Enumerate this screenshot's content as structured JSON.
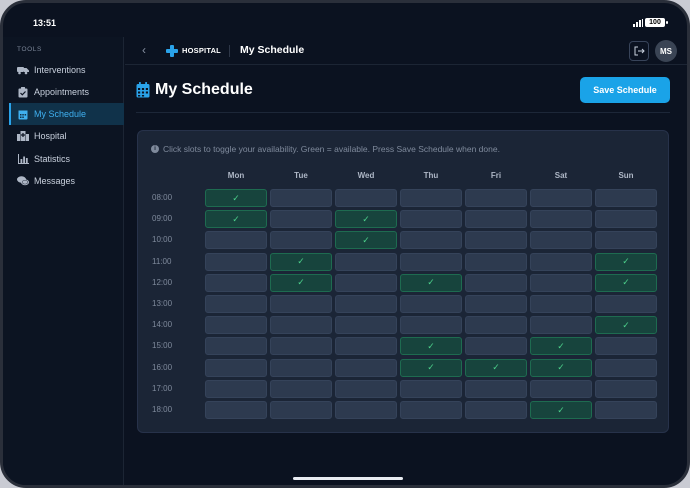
{
  "status_bar": {
    "time": "13:51",
    "battery": "100"
  },
  "sidebar": {
    "heading": "TOOLS",
    "items": [
      {
        "label": "Interventions",
        "icon": "ambulance-icon",
        "active": false
      },
      {
        "label": "Appointments",
        "icon": "clipboard-icon",
        "active": false
      },
      {
        "label": "My Schedule",
        "icon": "calendar-icon",
        "active": true
      },
      {
        "label": "Hospital",
        "icon": "hospital-building-icon",
        "active": false
      },
      {
        "label": "Statistics",
        "icon": "bar-chart-icon",
        "active": false
      },
      {
        "label": "Messages",
        "icon": "chat-bubbles-icon",
        "active": false
      }
    ]
  },
  "topbar": {
    "brand": "HOSPITAL",
    "title": "My Schedule",
    "avatar_initials": "MS"
  },
  "page": {
    "title": "My Schedule",
    "save_label": "Save Schedule",
    "info_text": "Click slots to toggle your availability. Green = available. Press Save Schedule when done."
  },
  "schedule": {
    "days": [
      "Mon",
      "Tue",
      "Wed",
      "Thu",
      "Fri",
      "Sat",
      "Sun"
    ],
    "times": [
      "08:00",
      "09:00",
      "10:00",
      "11:00",
      "12:00",
      "13:00",
      "14:00",
      "15:00",
      "16:00",
      "17:00",
      "18:00"
    ],
    "check_mark": "✓",
    "available": [
      [
        1,
        0,
        0,
        0,
        0,
        0,
        0
      ],
      [
        1,
        0,
        1,
        0,
        0,
        0,
        0
      ],
      [
        0,
        0,
        1,
        0,
        0,
        0,
        0
      ],
      [
        0,
        1,
        0,
        0,
        0,
        0,
        1
      ],
      [
        0,
        1,
        0,
        1,
        0,
        0,
        1
      ],
      [
        0,
        0,
        0,
        0,
        0,
        0,
        0
      ],
      [
        0,
        0,
        0,
        0,
        0,
        0,
        1
      ],
      [
        0,
        0,
        0,
        1,
        0,
        1,
        0
      ],
      [
        0,
        0,
        0,
        1,
        1,
        1,
        0
      ],
      [
        0,
        0,
        0,
        0,
        0,
        0,
        0
      ],
      [
        0,
        0,
        0,
        0,
        0,
        1,
        0
      ]
    ]
  },
  "colors": {
    "accent": "#1aa3e8",
    "available_bg": "#17443d",
    "slot_bg": "#2d3a4f",
    "check": "#4ccf8a"
  }
}
